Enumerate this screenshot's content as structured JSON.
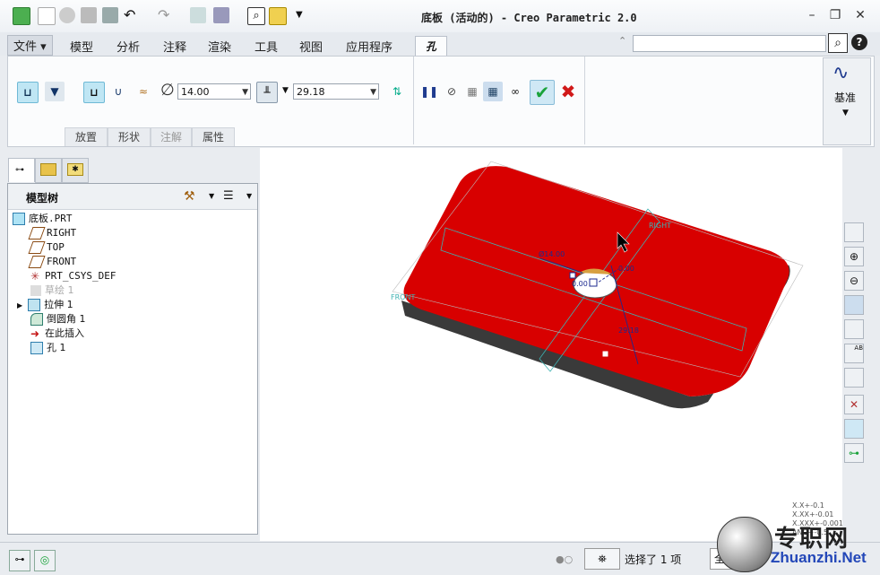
{
  "window": {
    "title": "底板 (活动的) - Creo Parametric 2.0"
  },
  "menu": {
    "tabs": [
      "文件",
      "模型",
      "分析",
      "注释",
      "渲染",
      "工具",
      "视图",
      "应用程序"
    ],
    "active_tab": "孔"
  },
  "ribbon": {
    "diameter_symbol": "∅",
    "diameter_value": "14.00",
    "depth_value": "29.18",
    "datum_label": "基准",
    "subtabs": [
      "放置",
      "形状",
      "注解",
      "属性"
    ]
  },
  "model_tree": {
    "header": "模型树",
    "items": [
      {
        "label": "底板.PRT",
        "icon": "part-icon",
        "indent": 0
      },
      {
        "label": "RIGHT",
        "icon": "datum-plane-icon",
        "indent": 1
      },
      {
        "label": "TOP",
        "icon": "datum-plane-icon",
        "indent": 1
      },
      {
        "label": "FRONT",
        "icon": "datum-plane-icon",
        "indent": 1
      },
      {
        "label": "PRT_CSYS_DEF",
        "icon": "csys-icon",
        "indent": 1
      },
      {
        "label": "草绘 1",
        "icon": "sketch-icon",
        "indent": 1
      },
      {
        "label": "拉伸 1",
        "icon": "extrude-icon",
        "indent": 1
      },
      {
        "label": "倒圆角 1",
        "icon": "round-icon",
        "indent": 1
      },
      {
        "label": "在此插入",
        "icon": "insert-arrow-icon",
        "indent": 1
      },
      {
        "label": "孔 1",
        "icon": "hole-icon",
        "indent": 1
      }
    ]
  },
  "viewport": {
    "labels": {
      "right": "RIGHT",
      "front": "FRONT",
      "dim_diameter": "Ø14.00",
      "dim_offset1": "0.00",
      "dim_offset2": "0.00",
      "dim_depth": "29.18"
    },
    "tolerance_table": [
      "X.X+-0.1",
      "X.XX+-0.01",
      "X.XXX+-0.001",
      "ANG+-0.5"
    ]
  },
  "status": {
    "selection_text": "选择了 1 项",
    "filter_prefix": "全"
  },
  "watermark": {
    "brand": "专职网",
    "url": "Zhuanzhi.Net"
  },
  "colors": {
    "model_red": "#d80000",
    "accent_green": "#1aa33b",
    "cancel_red": "#d11919"
  }
}
